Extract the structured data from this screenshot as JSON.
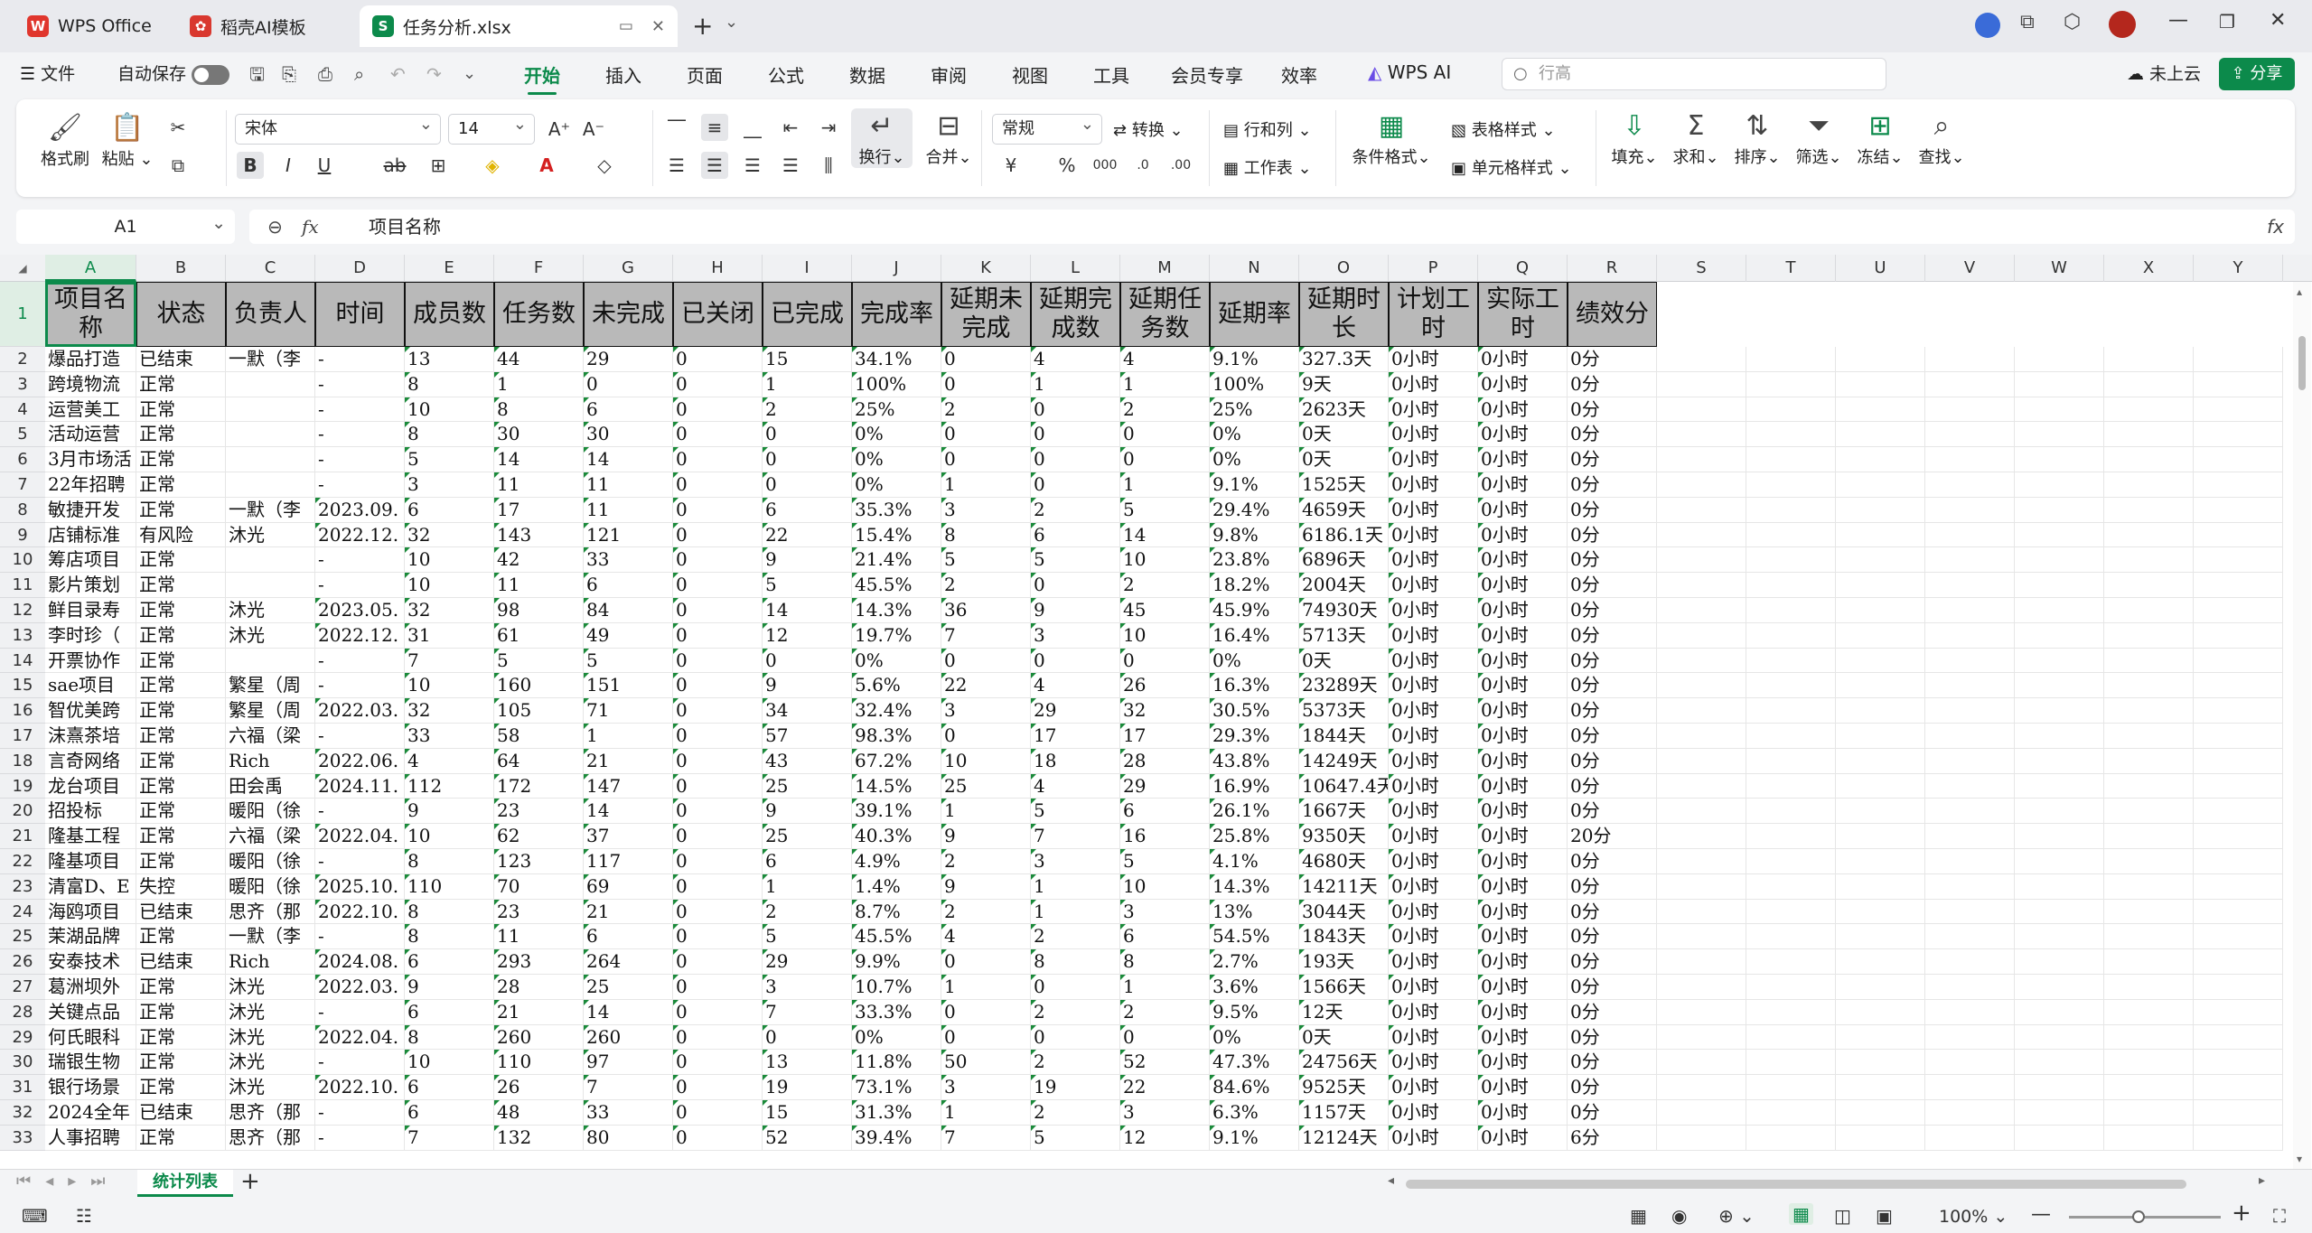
{
  "tabs": [
    {
      "label": "WPS Office",
      "icon": "W",
      "color": "#e0362d"
    },
    {
      "label": "稻壳AI模板",
      "icon": "✿",
      "color": "#d9382f"
    },
    {
      "label": "任务分析.xlsx",
      "icon": "S",
      "color": "#0c8a4b"
    }
  ],
  "menu": {
    "file": "文件",
    "autosave": "自动保存",
    "tabs": [
      "开始",
      "插入",
      "页面",
      "公式",
      "数据",
      "审阅",
      "视图",
      "工具",
      "会员专享",
      "效率",
      "WPS AI"
    ],
    "search_placeholder": "行高",
    "cloud": "未上云",
    "share": "分享"
  },
  "ribbon": {
    "format_painter": "格式刷",
    "paste": "粘贴",
    "font": "宋体",
    "size": "14",
    "wrap": "换行",
    "merge": "合并",
    "number_format": "常规",
    "convert": "转换",
    "rows_cols": "行和列",
    "worksheet": "工作表",
    "cond_format": "条件格式",
    "table_style": "表格样式",
    "cell_style": "单元格样式",
    "fill": "填充",
    "sum": "求和",
    "sort": "排序",
    "filter": "筛选",
    "freeze": "冻结",
    "find": "查找"
  },
  "formula": {
    "cell_ref": "A1",
    "content": "项目名称"
  },
  "sheet": {
    "columns": [
      "A",
      "B",
      "C",
      "D",
      "E",
      "F",
      "G",
      "H",
      "I",
      "J",
      "K",
      "L",
      "M",
      "N",
      "O",
      "P",
      "Q",
      "R",
      "S",
      "T",
      "U",
      "V",
      "W",
      "X",
      "Y"
    ],
    "headers": [
      "项目名称",
      "状态",
      "负责人",
      "时间",
      "成员数",
      "任务数",
      "未完成",
      "已关闭",
      "已完成",
      "完成率",
      "延期未完成",
      "延期完成数",
      "延期任务数",
      "延期率",
      "延期时长",
      "计划工时",
      "实际工时",
      "绩效分"
    ],
    "rows": [
      [
        "爆品打造",
        "已结束",
        "一默（李",
        "-",
        "13",
        "44",
        "29",
        "0",
        "15",
        "34.1%",
        "0",
        "4",
        "4",
        "9.1%",
        "327.3天",
        "0小时",
        "0小时",
        "0分"
      ],
      [
        "跨境物流",
        "正常",
        "",
        "-",
        "8",
        "1",
        "0",
        "0",
        "1",
        "100%",
        "0",
        "1",
        "1",
        "100%",
        "9天",
        "0小时",
        "0小时",
        "0分"
      ],
      [
        "运营美工",
        "正常",
        "",
        "-",
        "10",
        "8",
        "6",
        "0",
        "2",
        "25%",
        "2",
        "0",
        "2",
        "25%",
        "2623天",
        "0小时",
        "0小时",
        "0分"
      ],
      [
        "活动运营",
        "正常",
        "",
        "-",
        "8",
        "30",
        "30",
        "0",
        "0",
        "0%",
        "0",
        "0",
        "0",
        "0%",
        "0天",
        "0小时",
        "0小时",
        "0分"
      ],
      [
        "3月市场活",
        "正常",
        "",
        "-",
        "5",
        "14",
        "14",
        "0",
        "0",
        "0%",
        "0",
        "0",
        "0",
        "0%",
        "0天",
        "0小时",
        "0小时",
        "0分"
      ],
      [
        "22年招聘",
        "正常",
        "",
        "-",
        "3",
        "11",
        "11",
        "0",
        "0",
        "0%",
        "1",
        "0",
        "1",
        "9.1%",
        "1525天",
        "0小时",
        "0小时",
        "0分"
      ],
      [
        "敏捷开发",
        "正常",
        "一默（李",
        "2023.09.",
        "6",
        "17",
        "11",
        "0",
        "6",
        "35.3%",
        "3",
        "2",
        "5",
        "29.4%",
        "4659天",
        "0小时",
        "0小时",
        "0分"
      ],
      [
        "店铺标准",
        "有风险",
        "沐光",
        "2022.12.",
        "32",
        "143",
        "121",
        "0",
        "22",
        "15.4%",
        "8",
        "6",
        "14",
        "9.8%",
        "6186.1天",
        "0小时",
        "0小时",
        "0分"
      ],
      [
        "筹店项目",
        "正常",
        "",
        "-",
        "10",
        "42",
        "33",
        "0",
        "9",
        "21.4%",
        "5",
        "5",
        "10",
        "23.8%",
        "6896天",
        "0小时",
        "0小时",
        "0分"
      ],
      [
        "影片策划",
        "正常",
        "",
        "-",
        "10",
        "11",
        "6",
        "0",
        "5",
        "45.5%",
        "2",
        "0",
        "2",
        "18.2%",
        "2004天",
        "0小时",
        "0小时",
        "0分"
      ],
      [
        "鲜目录寿",
        "正常",
        "沐光",
        "2023.05.",
        "32",
        "98",
        "84",
        "0",
        "14",
        "14.3%",
        "36",
        "9",
        "45",
        "45.9%",
        "74930天",
        "0小时",
        "0小时",
        "0分"
      ],
      [
        "李时珍（",
        "正常",
        "沐光",
        "2022.12.",
        "31",
        "61",
        "49",
        "0",
        "12",
        "19.7%",
        "7",
        "3",
        "10",
        "16.4%",
        "5713天",
        "0小时",
        "0小时",
        "0分"
      ],
      [
        "开票协作",
        "正常",
        "",
        "-",
        "7",
        "5",
        "5",
        "0",
        "0",
        "0%",
        "0",
        "0",
        "0",
        "0%",
        "0天",
        "0小时",
        "0小时",
        "0分"
      ],
      [
        "sae项目",
        "正常",
        "繁星（周",
        "-",
        "10",
        "160",
        "151",
        "0",
        "9",
        "5.6%",
        "22",
        "4",
        "26",
        "16.3%",
        "23289天",
        "0小时",
        "0小时",
        "0分"
      ],
      [
        "智优美跨",
        "正常",
        "繁星（周",
        "2022.03.",
        "32",
        "105",
        "71",
        "0",
        "34",
        "32.4%",
        "3",
        "29",
        "32",
        "30.5%",
        "5373天",
        "0小时",
        "0小时",
        "0分"
      ],
      [
        "沫熹茶培",
        "正常",
        "六福（梁",
        "-",
        "33",
        "58",
        "1",
        "0",
        "57",
        "98.3%",
        "0",
        "17",
        "17",
        "29.3%",
        "1844天",
        "0小时",
        "0小时",
        "0分"
      ],
      [
        "言奇网络",
        "正常",
        "Rich",
        "2022.06.",
        "4",
        "64",
        "21",
        "0",
        "43",
        "67.2%",
        "10",
        "18",
        "28",
        "43.8%",
        "14249天",
        "0小时",
        "0小时",
        "0分"
      ],
      [
        "龙台项目",
        "正常",
        "田会禹",
        "2024.11.",
        "112",
        "172",
        "147",
        "0",
        "25",
        "14.5%",
        "25",
        "4",
        "29",
        "16.9%",
        "10647.4天",
        "0小时",
        "0小时",
        "0分"
      ],
      [
        "招投标",
        "正常",
        "暖阳（徐",
        "-",
        "9",
        "23",
        "14",
        "0",
        "9",
        "39.1%",
        "1",
        "5",
        "6",
        "26.1%",
        "1667天",
        "0小时",
        "0小时",
        "0分"
      ],
      [
        "隆基工程",
        "正常",
        "六福（梁",
        "2022.04.",
        "10",
        "62",
        "37",
        "0",
        "25",
        "40.3%",
        "9",
        "7",
        "16",
        "25.8%",
        "9350天",
        "0小时",
        "0小时",
        "20分"
      ],
      [
        "隆基项目",
        "正常",
        "暖阳（徐",
        "-",
        "8",
        "123",
        "117",
        "0",
        "6",
        "4.9%",
        "2",
        "3",
        "5",
        "4.1%",
        "4680天",
        "0小时",
        "0小时",
        "0分"
      ],
      [
        "清富D、E",
        "失控",
        "暖阳（徐",
        "2025.10.",
        "110",
        "70",
        "69",
        "0",
        "1",
        "1.4%",
        "9",
        "1",
        "10",
        "14.3%",
        "14211天",
        "0小时",
        "0小时",
        "0分"
      ],
      [
        "海鸥项目",
        "已结束",
        "思齐（那",
        "2022.10.",
        "8",
        "23",
        "21",
        "0",
        "2",
        "8.7%",
        "2",
        "1",
        "3",
        "13%",
        "3044天",
        "0小时",
        "0小时",
        "0分"
      ],
      [
        "茉湖品牌",
        "正常",
        "一默（李",
        "-",
        "8",
        "11",
        "6",
        "0",
        "5",
        "45.5%",
        "4",
        "2",
        "6",
        "54.5%",
        "1843天",
        "0小时",
        "0小时",
        "0分"
      ],
      [
        "安泰技术",
        "已结束",
        "Rich",
        "2024.08.",
        "6",
        "293",
        "264",
        "0",
        "29",
        "9.9%",
        "0",
        "8",
        "8",
        "2.7%",
        "193天",
        "0小时",
        "0小时",
        "0分"
      ],
      [
        "葛洲坝外",
        "正常",
        "沐光",
        "2022.03.",
        "9",
        "28",
        "25",
        "0",
        "3",
        "10.7%",
        "1",
        "0",
        "1",
        "3.6%",
        "1566天",
        "0小时",
        "0小时",
        "0分"
      ],
      [
        "关键点品",
        "正常",
        "沐光",
        "-",
        "6",
        "21",
        "14",
        "0",
        "7",
        "33.3%",
        "0",
        "2",
        "2",
        "9.5%",
        "12天",
        "0小时",
        "0小时",
        "0分"
      ],
      [
        "何氏眼科",
        "正常",
        "沐光",
        "2022.04.",
        "8",
        "260",
        "260",
        "0",
        "0",
        "0%",
        "0",
        "0",
        "0",
        "0%",
        "0天",
        "0小时",
        "0小时",
        "0分"
      ],
      [
        "瑞银生物",
        "正常",
        "沐光",
        "-",
        "10",
        "110",
        "97",
        "0",
        "13",
        "11.8%",
        "50",
        "2",
        "52",
        "47.3%",
        "24756天",
        "0小时",
        "0小时",
        "0分"
      ],
      [
        "银行场景",
        "正常",
        "沐光",
        "2022.10.",
        "6",
        "26",
        "7",
        "0",
        "19",
        "73.1%",
        "3",
        "19",
        "22",
        "84.6%",
        "9525天",
        "0小时",
        "0小时",
        "0分"
      ],
      [
        "2024全年",
        "已结束",
        "思齐（那",
        "-",
        "6",
        "48",
        "33",
        "0",
        "15",
        "31.3%",
        "1",
        "2",
        "3",
        "6.3%",
        "1157天",
        "0小时",
        "0小时",
        "0分"
      ],
      [
        "人事招聘",
        "正常",
        "思齐（那",
        "-",
        "7",
        "132",
        "80",
        "0",
        "52",
        "39.4%",
        "7",
        "5",
        "12",
        "9.1%",
        "12124天",
        "0小时",
        "0小时",
        "6分"
      ]
    ],
    "sheet_tab": "统计列表"
  },
  "status": {
    "zoom": "100%"
  }
}
